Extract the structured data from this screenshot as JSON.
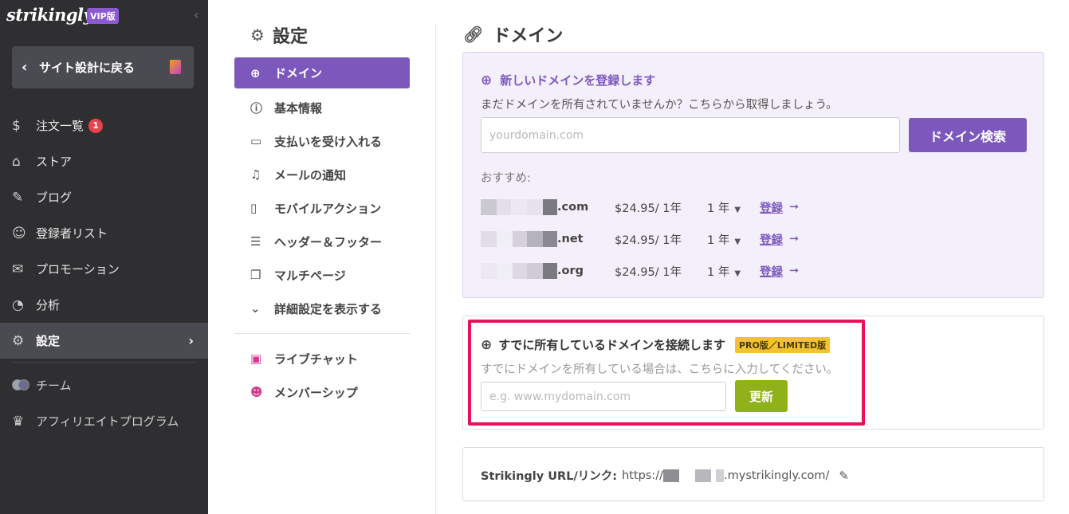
{
  "sidebar": {
    "brand": "strikingly",
    "vip": "VIP版",
    "collapse_icon": "‹",
    "back_label": "サイト設計に戻る",
    "items": [
      {
        "label": "注文一覧",
        "icon": "$",
        "badge": "1"
      },
      {
        "label": "ストア",
        "icon": "⌂"
      },
      {
        "label": "ブログ",
        "icon": "✎"
      },
      {
        "label": "登録者リスト",
        "icon": "☺"
      },
      {
        "label": "プロモーション",
        "icon": "✉"
      },
      {
        "label": "分析",
        "icon": "◔"
      },
      {
        "label": "設定",
        "icon": "⚙",
        "active": true
      },
      {
        "label": "チーム"
      },
      {
        "label": "アフィリエイトプログラム",
        "icon": "♛"
      }
    ]
  },
  "settings": {
    "title": "設定",
    "items": [
      {
        "label": "ドメイン",
        "icon": "⊕"
      },
      {
        "label": "基本情報",
        "icon": "ⓘ"
      },
      {
        "label": "支払いを受け入れる",
        "icon": "▭"
      },
      {
        "label": "メールの通知",
        "icon": "♫"
      },
      {
        "label": "モバイルアクション",
        "icon": "▯"
      },
      {
        "label": "ヘッダー＆フッター",
        "icon": "☰"
      },
      {
        "label": "マルチページ",
        "icon": "❐"
      },
      {
        "label": "詳細設定を表示する",
        "icon": "⌄"
      }
    ],
    "extra": [
      {
        "label": "ライブチャット",
        "icon": "▣"
      },
      {
        "label": "メンバーシップ",
        "icon": "☻"
      }
    ]
  },
  "domain": {
    "title": "ドメイン",
    "new_card": {
      "title": "新しいドメインを登録します",
      "subtitle": "まだドメインを所有されていませんか？こちらから取得しましょう。",
      "placeholder": "yourdomain.com",
      "search_button": "ドメイン検索",
      "recommend_label": "おすすめ:",
      "suggestions": [
        {
          "tld": ".com",
          "price": "$24.95/ 1年",
          "period": "1 年",
          "register": "登録"
        },
        {
          "tld": ".net",
          "price": "$24.95/ 1年",
          "period": "1 年",
          "register": "登録"
        },
        {
          "tld": ".org",
          "price": "$24.95/ 1年",
          "period": "1 年",
          "register": "登録"
        }
      ]
    },
    "connect_card": {
      "title": "すでに所有しているドメインを接続します",
      "badge": "PRO版／LIMITED版",
      "subtitle": "すでにドメインを所有している場合は、こちらに入力してください。",
      "placeholder": "e.g. www.mydomain.com",
      "update_button": "更新"
    },
    "url_card": {
      "label": "Strikingly URL/リンク:",
      "prefix": "https://",
      "suffix": ".mystrikingly.com/"
    }
  },
  "colors": {
    "sidebar_bg": "#2f2f31",
    "accent_purple": "#7c58bd",
    "update_green": "#8fb21a",
    "highlight_pink": "#e8115c",
    "pro_badge_yellow": "#f2c230"
  }
}
